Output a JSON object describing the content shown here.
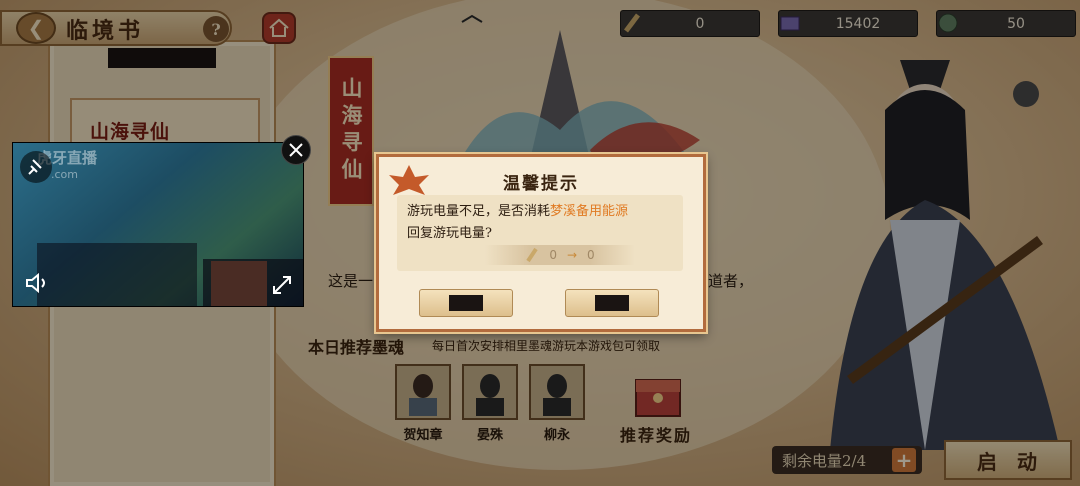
{
  "header": {
    "title": "临境书",
    "help": "?"
  },
  "resources": [
    {
      "icon": "pen-icon",
      "value": "0"
    },
    {
      "icon": "treasure-box-icon",
      "value": "15402"
    },
    {
      "icon": "jade-coin-icon",
      "value": "50"
    }
  ],
  "left_panel": {
    "banner_title": "山海寻仙"
  },
  "vertical_banner": "山海寻仙",
  "middle": {
    "text_left": "这是一",
    "text_right": "道者，"
  },
  "recommend": {
    "title": "本日推荐墨魂",
    "desc": "每日首次安排相里墨魂游玩本游戏包可领取",
    "characters": [
      {
        "name": "贺知章",
        "icon": "portrait-icon"
      },
      {
        "name": "晏殊",
        "icon": "locked-portrait-icon"
      },
      {
        "name": "柳永",
        "icon": "locked-portrait-icon"
      }
    ],
    "reward_label": "推荐奖励"
  },
  "energy": {
    "label": "剩余电量2/4",
    "plus": "+"
  },
  "start_button": "启动",
  "dialog": {
    "title": "温馨提示",
    "msg_prefix": "游玩电量不足，是否消耗",
    "msg_highlight": "梦溪备用能源",
    "msg_suffix": "回复游玩电量?",
    "conv_from": "0",
    "conv_arrow": "→",
    "conv_to": "0"
  },
  "video": {
    "watermark": "虎牙直播",
    "watermark_sub": ".com"
  },
  "colors": {
    "highlight": "#e07a22",
    "banner_red": "#a92c22",
    "dialog_border": "#b26b3d"
  }
}
